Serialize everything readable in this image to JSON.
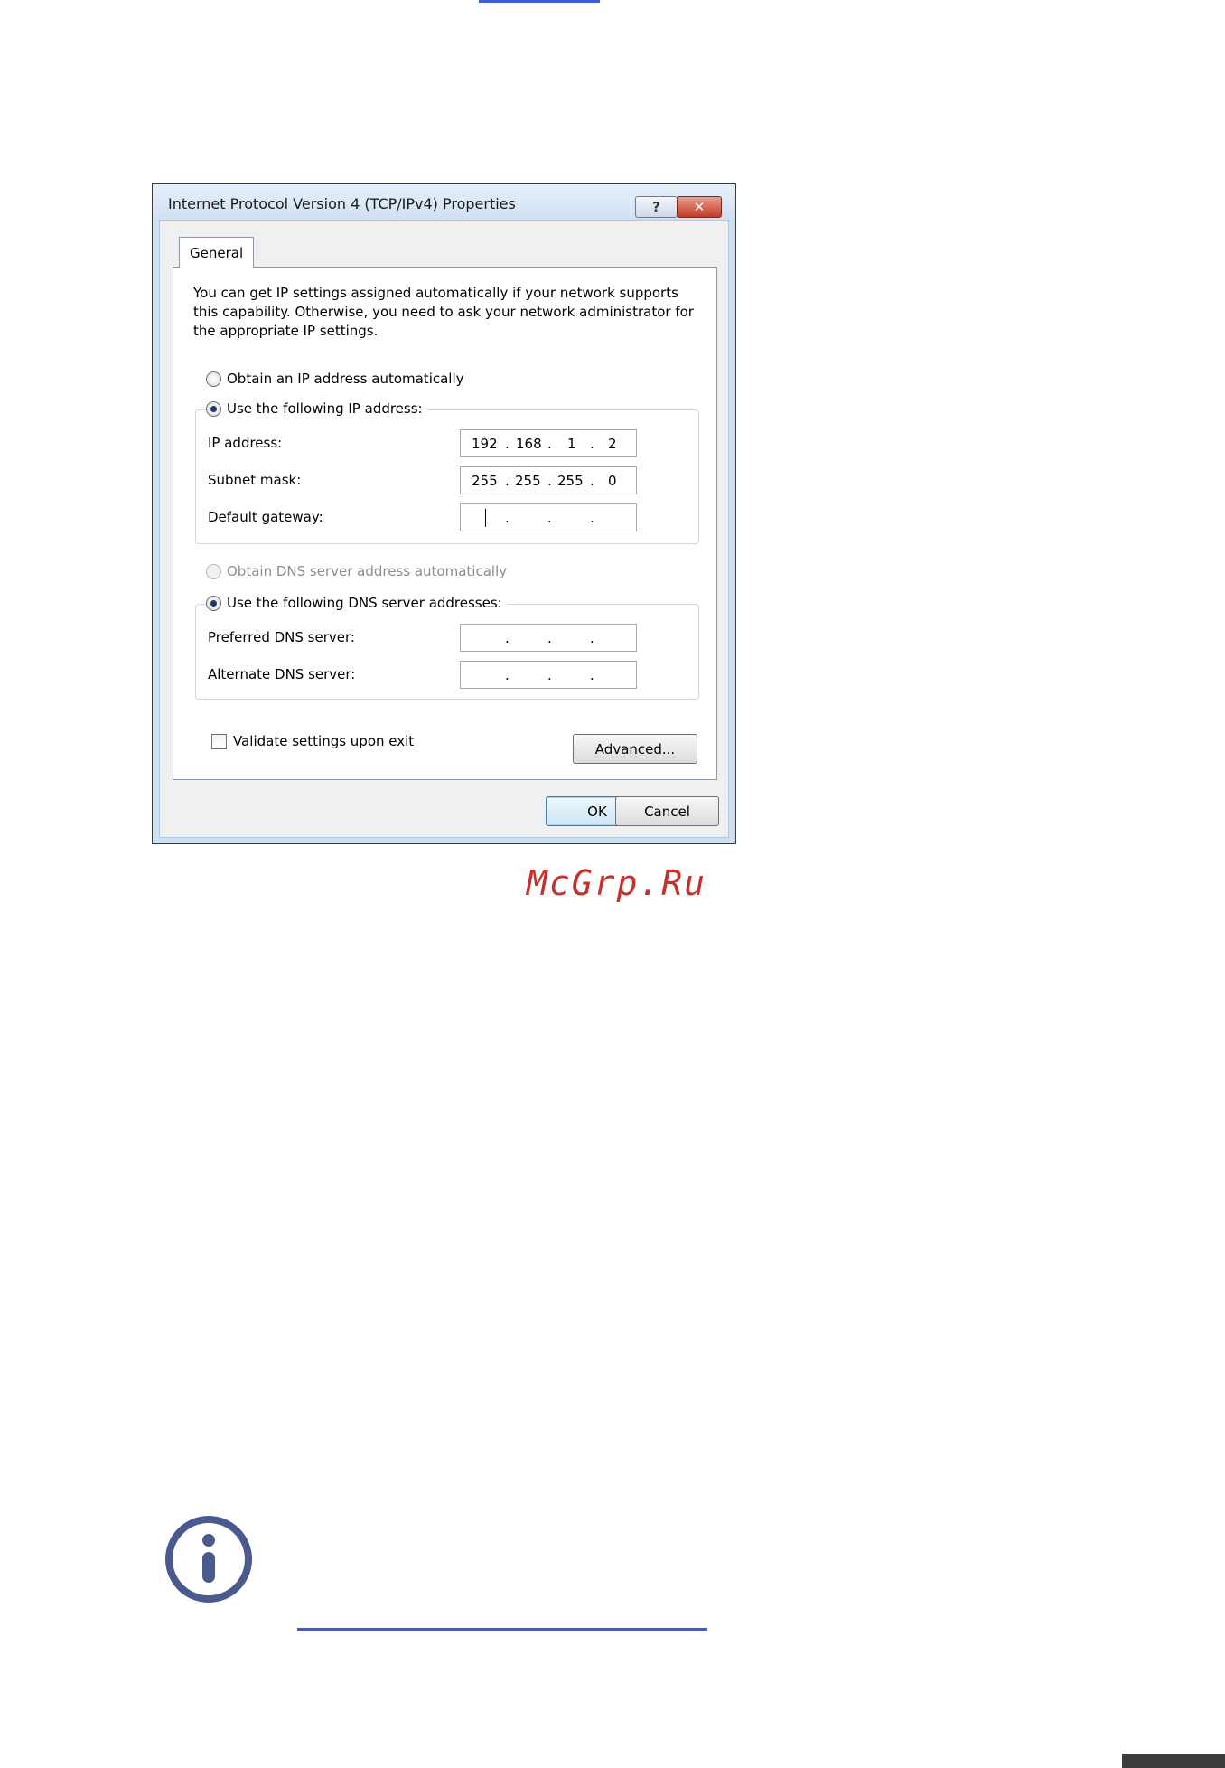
{
  "dialog": {
    "title": "Internet Protocol Version 4 (TCP/IPv4) Properties",
    "help_glyph": "?",
    "close_glyph": "✕",
    "tab_general": "General",
    "intro": "You can get IP settings assigned automatically if your network supports this capability. Otherwise, you need to ask your network administrator for the appropriate IP settings.",
    "radio_obtain_ip": "Obtain an IP address automatically",
    "radio_use_ip": "Use the following IP address:",
    "ip_label": "IP address:",
    "ip_value": [
      "192",
      "168",
      "1",
      "2"
    ],
    "subnet_label": "Subnet mask:",
    "subnet_value": [
      "255",
      "255",
      "255",
      "0"
    ],
    "gateway_label": "Default gateway:",
    "radio_obtain_dns": "Obtain DNS server address automatically",
    "radio_use_dns": "Use the following DNS server addresses:",
    "preferred_dns_label": "Preferred DNS server:",
    "alternate_dns_label": "Alternate DNS server:",
    "dot": ".",
    "validate_label": "Validate settings upon exit",
    "advanced_button": "Advanced...",
    "ok_button": "OK",
    "cancel_button": "Cancel"
  },
  "watermark": "McGrp.Ru",
  "colors": {
    "link_underline": "#3b5bdb",
    "info_icon": "#4a5a8f",
    "watermark": "#c9302c",
    "close_button": "#c23a24"
  }
}
